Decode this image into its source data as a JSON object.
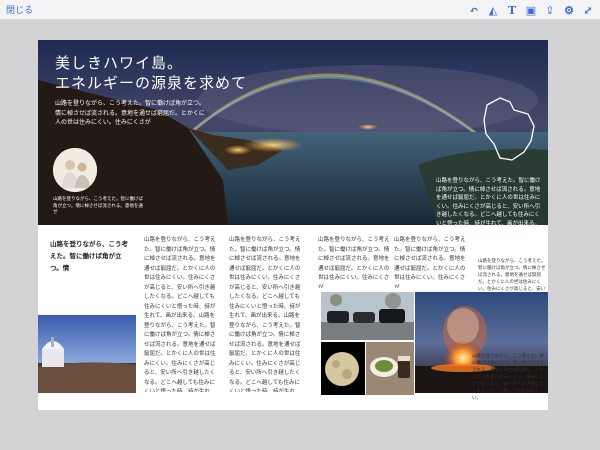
{
  "toolbar": {
    "close_label": "閉じる",
    "tools": [
      {
        "icon": "undo-icon",
        "glyph": "↶"
      },
      {
        "icon": "ink-icon",
        "glyph": "◭"
      },
      {
        "icon": "text-icon",
        "glyph": "T"
      },
      {
        "icon": "image-icon",
        "glyph": "▣"
      },
      {
        "icon": "share-icon",
        "glyph": "⇪"
      },
      {
        "icon": "settings-icon",
        "glyph": "⚙"
      },
      {
        "icon": "expand-icon",
        "glyph": "⤢"
      }
    ]
  },
  "colors": {
    "accent": "#3a6ed8",
    "toolbar_bg": "#f4f4f6",
    "canvas_bg": "#d3d3d5",
    "page_bg": "#ffffff"
  },
  "hero": {
    "title_line1": "美しきハワイ島。",
    "title_line2": "エネルギーの源泉を求めて",
    "body": "山路を登りながら、こう考えた。智に働けば角が立つ。情に棹させば流される。意地を通せば窮屈だ。とかくに人の世は住みにくい。住みにくさが",
    "portrait_caption": "山路を登りながら、こう考えた。智に働けば角が立つ。情に棹させば流される。意地を通せ",
    "right_text": "山路を登りながら、こう考えた。智に働けば角が立つ。情に棹させば流される。意地を通せば窮屈だ。とかくに人の世は住みにくい。住みにくさが高じると、安い所へ引き越したくなる。どこへ越しても住みにくいと悟った時、詩が生れて、画が出来る。"
  },
  "body": {
    "lead": "山路を登りながら、こう考えた。智に働けば角が立つ。情",
    "col1": "山路を登りながら、こう考えた。智に働けば角が立つ。情に棹させば流される。意地を通せば窮屈だ。とかくに人の世は住みにくい。住みにくさが高じると、安い所へ引き越したくなる。どこへ越しても住みにくいと悟った時、詩が生れて、画が出来る。山路を登りながら、こう考えた。智に働けば角が立つ。情に棹させば流される。意地を通せば窮屈だ。とかくに人の世は住みにくい。住みにくさが高じると、安い所へ引き越したくなる。どこへ越しても住みにくいと悟った時、詩が生れて、画が出来る。山路を登りながら、こう考えた。智に働けば角が立つ。",
    "col2": "山路を登りながら、こう考えた。智に働けば角が立つ。情に棹させば流される。意地を通せば窮屈だ。とかくに人の世は住みにくい。住みにくさが高じると、安い所へ引き越したくなる。どこへ越しても住みにくいと悟った時、詩が生れて、画が出来る。山路を登りながら、こう考えた。智に働けば角が立つ。情に棹させば流される。意地を通せば窮屈だ。とかくに人の世は住みにくい。住みにくさが高じると、安い所へ引き越したくなる。どこへ越しても住みにくいと悟った時、詩が生れて、画が出来る。山路を登りながら、こう考えた。智に働けば角が立つ。",
    "col3": "山路を登りながら、こう考えた。智に働けば角が立つ。情に棹させば流される。意地を通せば窮屈だ。とかくに人の世は住みにくい。住みにくさが",
    "col4": "山路を登りながら、こう考えた。智に働けば角が立つ。情に棹させば流される。意地を通せば窮屈だ。とかくに人の世は住みにくい。住みにくさが",
    "col5": "山路を登りながら、こう考えた。智に働けば角が立つ。情に棹させば流される。意地を通せば窮屈だ。とかくに人の世は住みにくい。住みにくさが高じると、安い所へ引き越したくなる。",
    "col6": "山路を登りながら、こう考えた。智に働けば角が立つ。情に棹させば流される。意地を通せば窮屈だ。とかくに人の世は住みにくい。住みにくさが高じると、安い所へ引き越したくなる。どこへ越しても住みにくい。"
  }
}
